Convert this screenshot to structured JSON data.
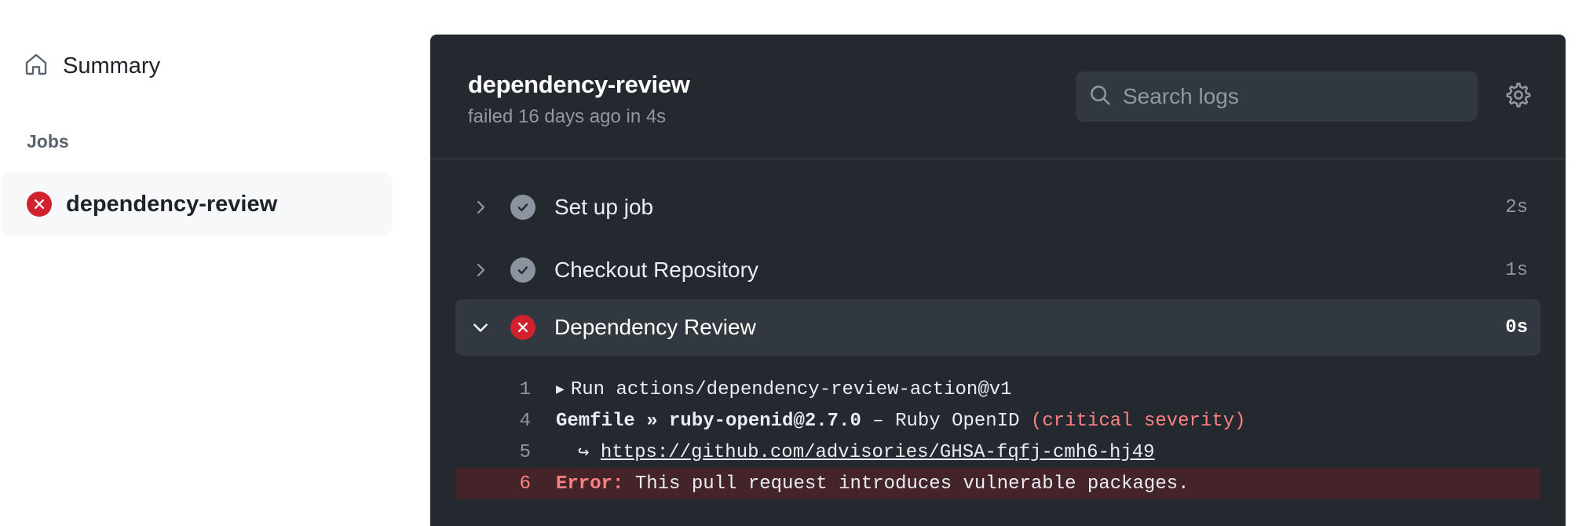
{
  "sidebar": {
    "summary_label": "Summary",
    "jobs_heading": "Jobs",
    "jobs": [
      {
        "label": "dependency-review",
        "status": "failed"
      }
    ]
  },
  "job": {
    "title": "dependency-review",
    "meta": "failed 16 days ago in 4s",
    "search_placeholder": "Search logs"
  },
  "steps": [
    {
      "name": "Set up job",
      "duration": "2s",
      "status": "success",
      "expanded": false
    },
    {
      "name": "Checkout Repository",
      "duration": "1s",
      "status": "success",
      "expanded": false
    },
    {
      "name": "Dependency Review",
      "duration": "0s",
      "status": "failed",
      "expanded": true
    }
  ],
  "log": {
    "line1": {
      "num": "1",
      "text": "Run actions/dependency-review-action@v1"
    },
    "line4": {
      "num": "4",
      "package": "Gemfile » ruby-openid@2.7.0",
      "desc": " – Ruby OpenID ",
      "severity": "(critical severity)"
    },
    "line5": {
      "num": "5",
      "arrow": "↪ ",
      "url": "https://github.com/advisories/GHSA-fqfj-cmh6-hj49"
    },
    "line6": {
      "num": "6",
      "label": "Error:",
      "text": " This pull request introduces vulnerable packages."
    }
  },
  "colors": {
    "panel_bg": "#24292f",
    "error": "#cf222e",
    "error_text": "#ff8182",
    "success_gray": "#8b949e"
  }
}
